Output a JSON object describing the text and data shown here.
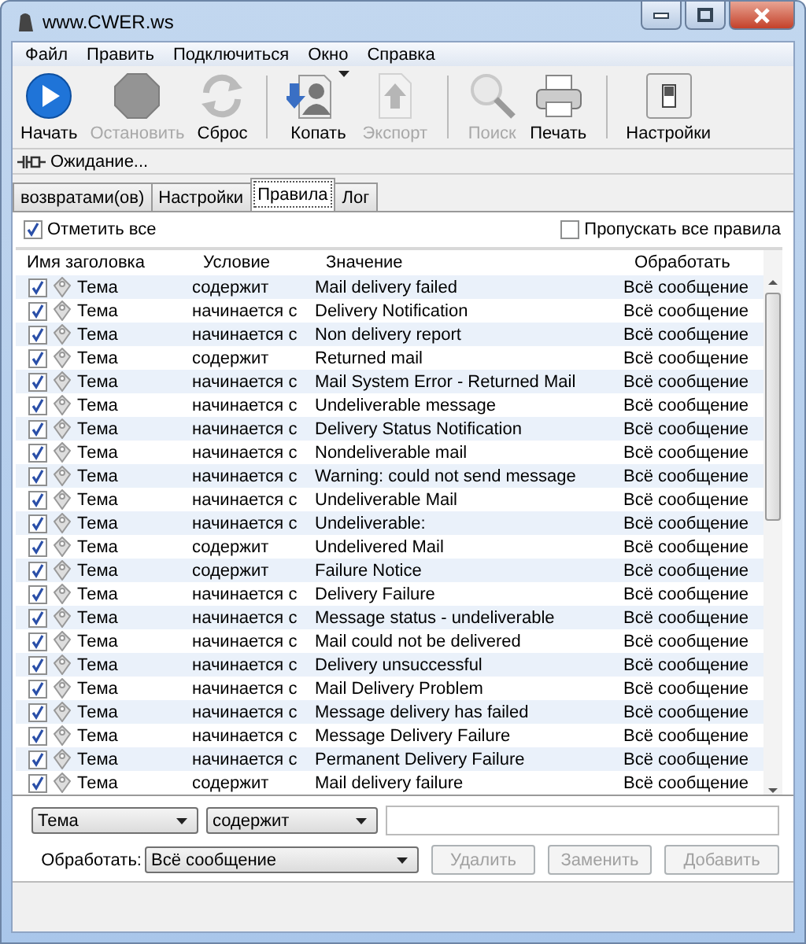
{
  "window": {
    "title": "www.CWER.ws"
  },
  "menu": [
    "Файл",
    "Править",
    "Подключиться",
    "Окно",
    "Справка"
  ],
  "toolbar": [
    {
      "kind": "play",
      "label": "Начать",
      "disabled": false,
      "dropdown": false
    },
    {
      "kind": "stop",
      "label": "Остановить",
      "disabled": true,
      "dropdown": false
    },
    {
      "kind": "reset",
      "label": "Сброс",
      "disabled": false,
      "dropdown": false
    },
    {
      "kind": "sep"
    },
    {
      "kind": "dig",
      "label": "Копать",
      "disabled": false,
      "dropdown": true
    },
    {
      "kind": "export",
      "label": "Экспорт",
      "disabled": true,
      "dropdown": false
    },
    {
      "kind": "sep"
    },
    {
      "kind": "search",
      "label": "Поиск",
      "disabled": true,
      "dropdown": false
    },
    {
      "kind": "print",
      "label": "Печать",
      "disabled": false,
      "dropdown": false
    },
    {
      "kind": "sep"
    },
    {
      "kind": "settings",
      "label": "Настройки",
      "disabled": false,
      "dropdown": false
    }
  ],
  "connection_status": "Ожидание...",
  "tabs": [
    {
      "label": "возвратами(ов)",
      "selected": false
    },
    {
      "label": "Настройки",
      "selected": false
    },
    {
      "label": "Правила",
      "selected": true
    },
    {
      "label": "Лог",
      "selected": false
    }
  ],
  "check_all": {
    "label": "Отметить все",
    "checked": true
  },
  "skip_all": {
    "label": "Пропускать все правила",
    "checked": false
  },
  "table": {
    "columns": [
      "Имя заголовка",
      "Условие",
      "Значение",
      "Обработать"
    ],
    "rows": [
      {
        "checked": true,
        "header": "Тема",
        "condition": "содержит",
        "value": "Mail delivery failed",
        "process": "Всё сообщение"
      },
      {
        "checked": true,
        "header": "Тема",
        "condition": "начинается с",
        "value": "Delivery Notification",
        "process": "Всё сообщение"
      },
      {
        "checked": true,
        "header": "Тема",
        "condition": "начинается с",
        "value": "Non delivery report",
        "process": "Всё сообщение"
      },
      {
        "checked": true,
        "header": "Тема",
        "condition": "содержит",
        "value": "Returned mail",
        "process": "Всё сообщение"
      },
      {
        "checked": true,
        "header": "Тема",
        "condition": "начинается с",
        "value": "Mail System Error - Returned Mail",
        "process": "Всё сообщение"
      },
      {
        "checked": true,
        "header": "Тема",
        "condition": "начинается с",
        "value": "Undeliverable message",
        "process": "Всё сообщение"
      },
      {
        "checked": true,
        "header": "Тема",
        "condition": "начинается с",
        "value": "Delivery Status Notification",
        "process": "Всё сообщение"
      },
      {
        "checked": true,
        "header": "Тема",
        "condition": "начинается с",
        "value": "Nondeliverable mail",
        "process": "Всё сообщение"
      },
      {
        "checked": true,
        "header": "Тема",
        "condition": "начинается с",
        "value": "Warning: could not send message",
        "process": "Всё сообщение"
      },
      {
        "checked": true,
        "header": "Тема",
        "condition": "начинается с",
        "value": "Undeliverable Mail",
        "process": "Всё сообщение"
      },
      {
        "checked": true,
        "header": "Тема",
        "condition": "начинается с",
        "value": "Undeliverable:",
        "process": "Всё сообщение"
      },
      {
        "checked": true,
        "header": "Тема",
        "condition": "содержит",
        "value": "Undelivered Mail",
        "process": "Всё сообщение"
      },
      {
        "checked": true,
        "header": "Тема",
        "condition": "содержит",
        "value": "Failure Notice",
        "process": "Всё сообщение"
      },
      {
        "checked": true,
        "header": "Тема",
        "condition": "начинается с",
        "value": "Delivery Failure",
        "process": "Всё сообщение"
      },
      {
        "checked": true,
        "header": "Тема",
        "condition": "начинается с",
        "value": "Message status - undeliverable",
        "process": "Всё сообщение"
      },
      {
        "checked": true,
        "header": "Тема",
        "condition": "начинается с",
        "value": "Mail could not be delivered",
        "process": "Всё сообщение"
      },
      {
        "checked": true,
        "header": "Тема",
        "condition": "начинается с",
        "value": "Delivery unsuccessful",
        "process": "Всё сообщение"
      },
      {
        "checked": true,
        "header": "Тема",
        "condition": "начинается с",
        "value": "Mail Delivery Problem",
        "process": "Всё сообщение"
      },
      {
        "checked": true,
        "header": "Тема",
        "condition": "начинается с",
        "value": "Message delivery has failed",
        "process": "Всё сообщение"
      },
      {
        "checked": true,
        "header": "Тема",
        "condition": "начинается с",
        "value": "Message Delivery Failure",
        "process": "Всё сообщение"
      },
      {
        "checked": true,
        "header": "Тема",
        "condition": "начинается с",
        "value": "Permanent Delivery Failure",
        "process": "Всё сообщение"
      },
      {
        "checked": true,
        "header": "Тема",
        "condition": "содержит",
        "value": "Mail delivery failure",
        "process": "Всё сообщение"
      }
    ]
  },
  "editor": {
    "header": "Тема",
    "condition": "содержит",
    "process_label": "Обработать:",
    "process": "Всё сообщение",
    "buttons": [
      {
        "label": "Удалить",
        "disabled": true
      },
      {
        "label": "Заменить",
        "disabled": true
      },
      {
        "label": "Добавить",
        "disabled": true
      }
    ]
  }
}
